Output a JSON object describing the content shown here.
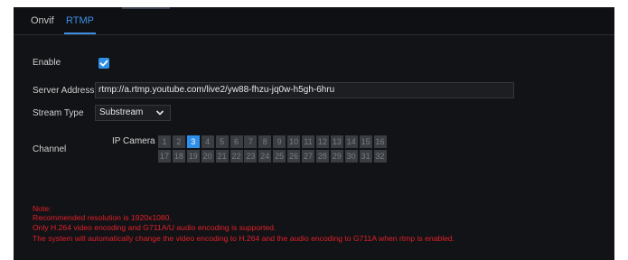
{
  "tabs": [
    {
      "label": "Onvif",
      "active": false
    },
    {
      "label": "RTMP",
      "active": true
    }
  ],
  "form": {
    "enable_label": "Enable",
    "enable_checked": true,
    "server_address_label": "Server Address",
    "server_address_value": "rtmp://a.rtmp.youtube.com/live2/yw88-fhzu-jq0w-h5gh-6hru",
    "stream_type_label": "Stream Type",
    "stream_type_value": "Substream",
    "channel_label": "Channel",
    "ip_camera_label": "IP Camera",
    "channels_row1": [
      "1",
      "2",
      "3",
      "4",
      "5",
      "6",
      "7",
      "8",
      "9",
      "10",
      "11",
      "12",
      "13",
      "14",
      "15",
      "16"
    ],
    "channels_row2": [
      "17",
      "18",
      "19",
      "20",
      "21",
      "22",
      "23",
      "24",
      "25",
      "26",
      "27",
      "28",
      "29",
      "30",
      "31",
      "32"
    ],
    "selected_channel": "3"
  },
  "notes": [
    "Note:",
    "Recommended resolution is 1920x1080.",
    "Only H.264 video encoding and G711A/U audio encoding is supported.",
    "The system will automatically change the video encoding to H.264 and the audio encoding to G711A when rtmp is enabled."
  ],
  "colors": {
    "accent": "#2e8fe8",
    "note": "#e0202a",
    "background": "#121316"
  }
}
